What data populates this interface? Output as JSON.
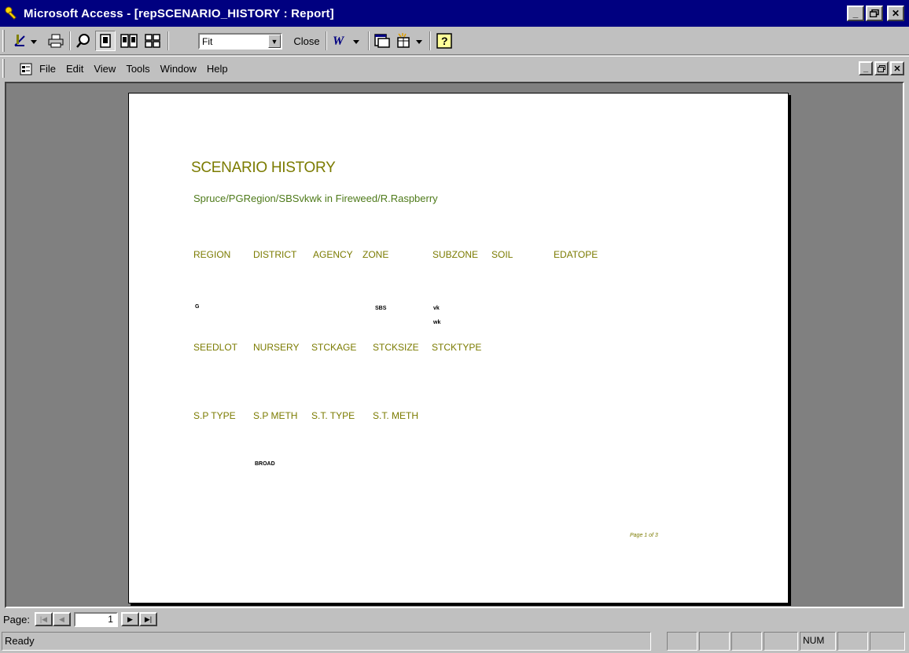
{
  "app": {
    "title": "Microsoft Access - [repSCENARIO_HISTORY : Report]"
  },
  "toolbar": {
    "zoom_value": "Fit",
    "close_label": "Close"
  },
  "menu": {
    "items": [
      "File",
      "Edit",
      "View",
      "Tools",
      "Window",
      "Help"
    ]
  },
  "report": {
    "title": "SCENARIO HISTORY",
    "subtitle": "Spruce/PGRegion/SBSvkwk in Fireweed/R.Raspberry",
    "header1": {
      "region": "REGION",
      "district": "DISTRICT",
      "agency": "AGENCY",
      "zone": "ZONE",
      "subzone": "SUBZONE",
      "soil": "SOIL",
      "edatope": "EDATOPE"
    },
    "values1": {
      "region": "G",
      "zone": "SBS",
      "subzone": "vk",
      "subzone2": "wk"
    },
    "header2": {
      "seedlot": "SEEDLOT",
      "nursery": "NURSERY",
      "stckage": "STCKAGE",
      "stcksize": "STCKSIZE",
      "stcktype": "STCKTYPE"
    },
    "header3": {
      "sp_type": "S.P TYPE",
      "sp_meth": "S.P METH",
      "st_type": "S.T. TYPE",
      "st_meth": "S.T. METH"
    },
    "values3": {
      "sp_meth": "BROAD"
    },
    "page_footer": "Page 1 of 3"
  },
  "navigation": {
    "label": "Page:",
    "current_page": "1"
  },
  "status": {
    "text": "Ready",
    "num": "NUM"
  }
}
